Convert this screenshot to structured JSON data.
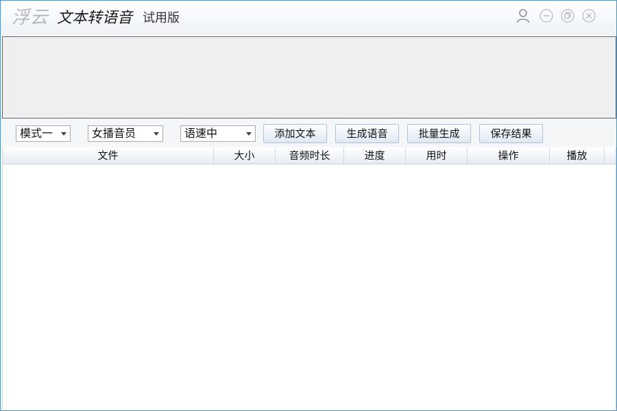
{
  "titlebar": {
    "logo_text": "浮云",
    "app_title": "文本转语音",
    "edition": "试用版",
    "icons": {
      "user": "user-icon",
      "minimize": "minimize-icon",
      "restore": "restore-icon",
      "close": "close-icon"
    }
  },
  "text_area": {
    "value": ""
  },
  "toolbar": {
    "mode": {
      "selected": "模式一"
    },
    "voice": {
      "selected": "女播音员"
    },
    "speed": {
      "selected": "语速中"
    },
    "add_text_label": "添加文本",
    "generate_label": "生成语音",
    "batch_label": "批量生成",
    "save_label": "保存结果"
  },
  "table": {
    "columns": [
      "文件",
      "大小",
      "音频时长",
      "进度",
      "用时",
      "操作",
      "播放"
    ],
    "rows": []
  }
}
